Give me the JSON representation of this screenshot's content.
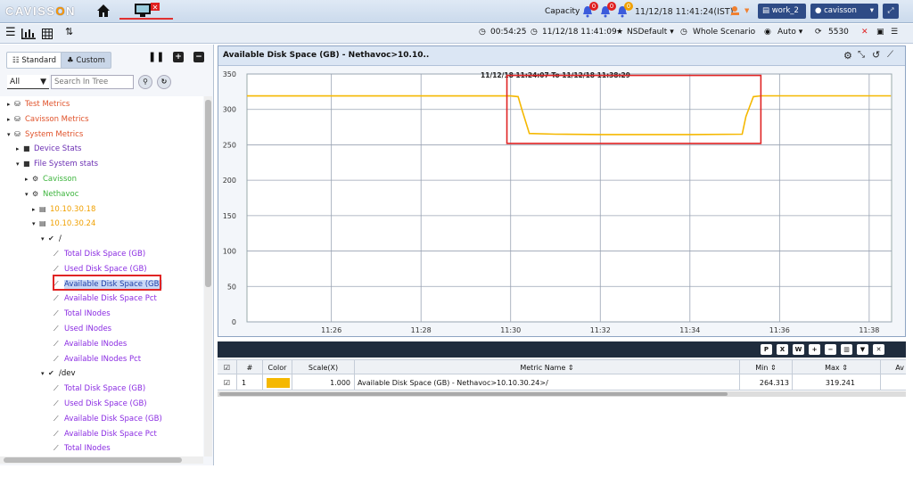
{
  "topbar": {
    "logo": "CAVISSON",
    "capacity_label": "Capacity",
    "bell_counts": [
      "0",
      "0",
      "0"
    ],
    "datetime": "11/12/18 11:41:24(IST)",
    "workspace": "work_2",
    "user": "cavisson",
    "icons": [
      "home-icon",
      "monitor-icon",
      "bell-icon",
      "orange-alert-icon",
      "expand-icon"
    ]
  },
  "toolbar": {
    "elapsed": "00:54:25",
    "start_time": "11/12/18 11:41:09",
    "favorite": "NSDefault",
    "scenario": "Whole Scenario",
    "view_mode": "Auto",
    "refresh": "5530"
  },
  "left_panel": {
    "tabs": [
      "Standard",
      "Custom"
    ],
    "filter_value": "All",
    "search_placeholder": "Search In Tree",
    "tree": [
      {
        "label": "Test Metrics",
        "color": "#e0522a"
      },
      {
        "label": "Cavisson Metrics",
        "color": "#e0522a"
      },
      {
        "label": "System Metrics",
        "color": "#e0522a"
      },
      {
        "label": "Device Stats",
        "color": "#6b2fb3"
      },
      {
        "label": "File System stats",
        "color": "#6b2fb3"
      },
      {
        "label": "Cavisson",
        "color": "#3cb43c"
      },
      {
        "label": "Nethavoc",
        "color": "#3cb43c"
      },
      {
        "label": "10.10.30.18",
        "color": "#f0a000"
      },
      {
        "label": "10.10.30.24",
        "color": "#f0a000"
      },
      {
        "label": "/",
        "color": "#111111"
      },
      {
        "label": "Total Disk Space (GB)",
        "color": "#8a2be2"
      },
      {
        "label": "Used Disk Space (GB)",
        "color": "#8a2be2"
      },
      {
        "label": "Available Disk Space (GB)",
        "color": "#1e3ea8"
      },
      {
        "label": "Available Disk Space Pct",
        "color": "#8a2be2"
      },
      {
        "label": "Total INodes",
        "color": "#8a2be2"
      },
      {
        "label": "Used INodes",
        "color": "#8a2be2"
      },
      {
        "label": "Available INodes",
        "color": "#8a2be2"
      },
      {
        "label": "Available INodes Pct",
        "color": "#8a2be2"
      },
      {
        "label": "/dev",
        "color": "#111111"
      },
      {
        "label": "Total Disk Space (GB)",
        "color": "#8a2be2"
      },
      {
        "label": "Used Disk Space (GB)",
        "color": "#8a2be2"
      },
      {
        "label": "Available Disk Space (GB)",
        "color": "#8a2be2"
      },
      {
        "label": "Available Disk Space Pct",
        "color": "#8a2be2"
      },
      {
        "label": "Total INodes",
        "color": "#8a2be2"
      }
    ]
  },
  "chart_panel": {
    "title": "Available Disk Space (GB) - Nethavoc>10.10..",
    "annotation": "11/12/18 11:24:07 To 11/12/18 11:38:29"
  },
  "chart_data": {
    "type": "line",
    "title": "",
    "xlabel": "",
    "ylabel": "",
    "ylim": [
      0,
      350
    ],
    "y_ticks": [
      "350",
      "300",
      "250",
      "200",
      "150",
      "100",
      "50",
      "0"
    ],
    "x_ticks": [
      "11:26",
      "11:28",
      "11:30",
      "11:32",
      "11:34",
      "11:36",
      "11:38"
    ],
    "grid": true,
    "series": [
      {
        "color": "#f5b800",
        "x": [
          "11:24:07",
          "11:26:00",
          "11:28:00",
          "11:30:00",
          "11:30:10",
          "11:30:15",
          "11:30:25",
          "11:31:00",
          "11:32:00",
          "11:34:00",
          "11:35:10",
          "11:35:15",
          "11:35:25",
          "11:35:35",
          "11:36:00",
          "11:38:00",
          "11:38:29"
        ],
        "y": [
          319,
          319,
          319,
          319,
          318,
          300,
          266,
          265,
          264.5,
          264.5,
          265,
          290,
          318,
          319.2,
          319.2,
          319.2,
          319.2
        ]
      }
    ],
    "highlight_box": {
      "x": [
        "11:29:55",
        "11:35:35"
      ]
    }
  },
  "grid": {
    "headers": [
      "#",
      "Color",
      "Scale(X)",
      "Metric Name",
      "Min",
      "Max",
      "Av"
    ],
    "rows": [
      {
        "num": "1",
        "color": "#f5b800",
        "scale": "1.000",
        "metric": "Available Disk Space (GB) - Nethavoc>10.10.30.24>/",
        "min": "264.313",
        "max": "319.241"
      }
    ],
    "toolbar_buttons": [
      "pdf-icon",
      "excel-icon",
      "doc-icon",
      "plus-icon",
      "minus-icon",
      "columns-icon",
      "filter-icon",
      "close-icon"
    ]
  }
}
